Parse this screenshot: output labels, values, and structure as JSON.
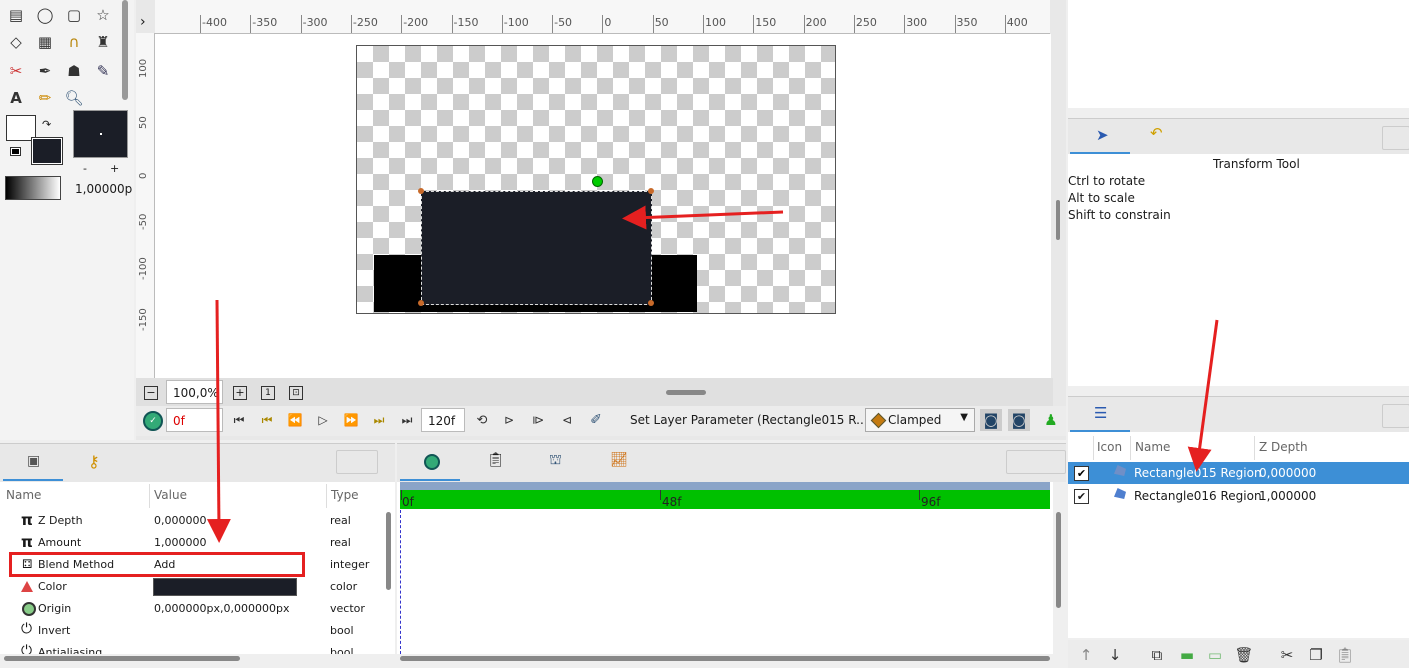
{
  "canvas_toolbar": {
    "ruler_top": [
      "-400",
      "-350",
      "-300",
      "-250",
      "-200",
      "-150",
      "-100",
      "-50",
      "0",
      "50",
      "100",
      "150",
      "200",
      "250",
      "300",
      "350",
      "400"
    ],
    "ruler_left": [
      "100",
      "50",
      "0",
      "-50",
      "-100",
      "-150"
    ]
  },
  "toolbox": {
    "tools": [
      "transform-icon",
      "circle-icon",
      "rectangle-icon",
      "star-icon",
      "eraser-icon",
      "gradient-icon",
      "spline-icon",
      "fill-icon",
      "cut-icon",
      "draw-icon",
      "bone-icon",
      "eyedropper-icon",
      "text-icon",
      "sketch-icon",
      "zoom-icon"
    ],
    "width_value": "1,00000p"
  },
  "canvas_bottom": {
    "zoom": "100,0%",
    "current_frame": "0f",
    "end_frame": "120f",
    "status": "Set Layer Parameter (Rectangle015 R...",
    "interpolation": "Clamped"
  },
  "params_panel": {
    "headers": {
      "name": "Name",
      "value": "Value",
      "type": "Type"
    },
    "rows": [
      {
        "name": "Z Depth",
        "value": "0,000000",
        "type": "real",
        "icon": "pi-icon"
      },
      {
        "name": "Amount",
        "value": "1,000000",
        "type": "real",
        "icon": "pi-icon"
      },
      {
        "name": "Blend Method",
        "value": "Add",
        "type": "integer",
        "icon": "blend-icon"
      },
      {
        "name": "Color",
        "value": "",
        "type": "color",
        "icon": "color-icon"
      },
      {
        "name": "Origin",
        "value": "0,000000px,0,000000px",
        "type": "vector",
        "icon": "origin-icon"
      },
      {
        "name": "Invert",
        "value": "",
        "type": "bool",
        "icon": "power-icon"
      },
      {
        "name": "Antialiasing",
        "value": "",
        "type": "bool",
        "icon": "power-icon"
      }
    ],
    "color_swatch": "#1b1e27"
  },
  "timetrack": {
    "markers": [
      "0f",
      "48f",
      "96f"
    ]
  },
  "tool_options": {
    "title": "Transform Tool",
    "lines": [
      "Ctrl to rotate",
      "Alt to scale",
      "Shift to constrain"
    ]
  },
  "layers_panel": {
    "headers": {
      "icon": "Icon",
      "name": "Name",
      "zdepth": "Z Depth"
    },
    "rows": [
      {
        "name": "Rectangle015 Region",
        "zdepth": "0,000000",
        "selected": true
      },
      {
        "name": "Rectangle016 Region",
        "zdepth": "1,000000",
        "selected": false
      }
    ]
  },
  "colors": {
    "selection": "#3d8fd6",
    "timebar": "#00c000",
    "rect_fill": "#1b1e27",
    "annotation": "#e52020"
  }
}
